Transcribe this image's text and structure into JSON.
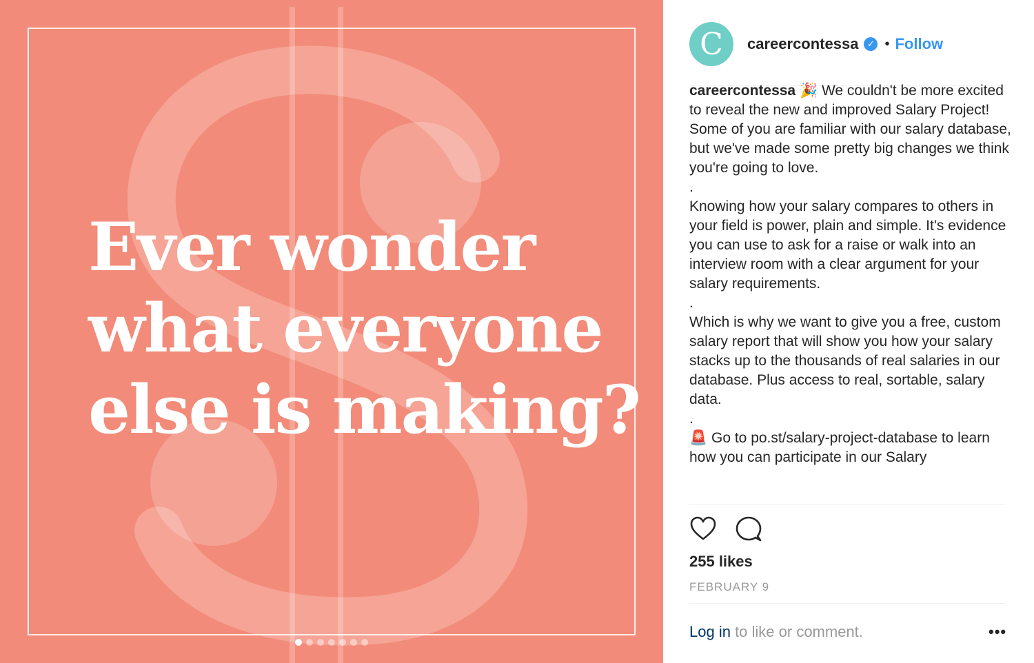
{
  "post": {
    "headline_lines": [
      "Ever wonder",
      "what everyone",
      "else is making?"
    ],
    "background_color": "#f28b79",
    "carousel": {
      "total": 7,
      "active": 1
    }
  },
  "header": {
    "avatar_letter": "C",
    "avatar_color": "#6fcec6",
    "username": "careercontessa",
    "verified_icon": "verified-badge-icon",
    "separator": "•",
    "follow_label": "Follow",
    "accent_color": "#3897f0"
  },
  "caption": {
    "username": "careercontessa",
    "emoji_party": "🎉",
    "p1": "We couldn't be more excited to reveal the new and improved Salary Project! Some of you are familiar with our salary database, but we've made some pretty big changes we think you're going to love.",
    "dot1": ".",
    "p2": "Knowing how your salary compares to others in your field is power, plain and simple. It's evidence you can use to ask for a raise or walk into an interview room with a clear argument for your salary requirements.",
    "dot2": ".",
    "p3": "Which is why we want to give you a free, custom salary report that will show you how your salary stacks up to the thousands of real salaries in our database. Plus access to real, sortable, salary data.",
    "dot3": ".",
    "emoji_siren": "🚨",
    "p4": "Go to po.st/salary-project-database to learn how you can participate in our Salary"
  },
  "actions": {
    "like_icon": "heart-icon",
    "comment_icon": "comment-icon"
  },
  "likes": "255 likes",
  "date": "FEBRUARY 9",
  "footer": {
    "login_link": "Log in",
    "login_rest": " to like or comment.",
    "more_label": "•••"
  }
}
